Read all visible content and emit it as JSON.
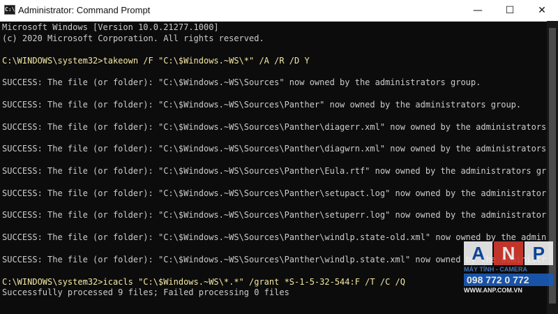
{
  "window": {
    "title": "Administrator: Command Prompt",
    "icon_label": "C:\\",
    "minimize_glyph": "—",
    "maximize_glyph": "☐",
    "close_glyph": "✕"
  },
  "console": {
    "lines": [
      {
        "text": "Microsoft Windows [Version 10.0.21277.1000]",
        "kind": "output"
      },
      {
        "text": "(c) 2020 Microsoft Corporation. All rights reserved.",
        "kind": "output"
      },
      {
        "text": "",
        "kind": "output"
      },
      {
        "text": "C:\\WINDOWS\\system32>takeown /F \"C:\\$Windows.~WS\\*\" /A /R /D Y",
        "kind": "command"
      },
      {
        "text": "",
        "kind": "output"
      },
      {
        "text": "SUCCESS: The file (or folder): \"C:\\$Windows.~WS\\Sources\" now owned by the administrators group.",
        "kind": "output"
      },
      {
        "text": "",
        "kind": "output"
      },
      {
        "text": "SUCCESS: The file (or folder): \"C:\\$Windows.~WS\\Sources\\Panther\" now owned by the administrators group.",
        "kind": "output"
      },
      {
        "text": "",
        "kind": "output"
      },
      {
        "text": "SUCCESS: The file (or folder): \"C:\\$Windows.~WS\\Sources\\Panther\\diagerr.xml\" now owned by the administrators group.",
        "kind": "output"
      },
      {
        "text": "",
        "kind": "output"
      },
      {
        "text": "SUCCESS: The file (or folder): \"C:\\$Windows.~WS\\Sources\\Panther\\diagwrn.xml\" now owned by the administrators group.",
        "kind": "output"
      },
      {
        "text": "",
        "kind": "output"
      },
      {
        "text": "SUCCESS: The file (or folder): \"C:\\$Windows.~WS\\Sources\\Panther\\Eula.rtf\" now owned by the administrators group.",
        "kind": "output"
      },
      {
        "text": "",
        "kind": "output"
      },
      {
        "text": "SUCCESS: The file (or folder): \"C:\\$Windows.~WS\\Sources\\Panther\\setupact.log\" now owned by the administrators group.",
        "kind": "output"
      },
      {
        "text": "",
        "kind": "output"
      },
      {
        "text": "SUCCESS: The file (or folder): \"C:\\$Windows.~WS\\Sources\\Panther\\setuperr.log\" now owned by the administrators group.",
        "kind": "output"
      },
      {
        "text": "",
        "kind": "output"
      },
      {
        "text": "SUCCESS: The file (or folder): \"C:\\$Windows.~WS\\Sources\\Panther\\windlp.state-old.xml\" now owned by the administrators group.",
        "kind": "output"
      },
      {
        "text": "",
        "kind": "output"
      },
      {
        "text": "SUCCESS: The file (or folder): \"C:\\$Windows.~WS\\Sources\\Panther\\windlp.state.xml\" now owned by the administrators group.",
        "kind": "output"
      },
      {
        "text": "",
        "kind": "output"
      },
      {
        "text": "C:\\WINDOWS\\system32>icacls \"C:\\$Windows.~WS\\*.*\" /grant *S-1-5-32-544:F /T /C /Q",
        "kind": "command"
      },
      {
        "text": "Successfully processed 9 files; Failed processing 0 files",
        "kind": "output"
      }
    ]
  },
  "watermark": {
    "letters": [
      "A",
      "N",
      "P"
    ],
    "tagline": "MÁY TÍNH - CAMERA",
    "phone": "098 772 0 772",
    "site": "WWW.ANP.COM.VN"
  },
  "colors": {
    "console_bg": "#0c0c0c",
    "console_text": "#cccccc",
    "command_text": "#f3e8a3",
    "titlebar_bg": "#ffffff"
  }
}
